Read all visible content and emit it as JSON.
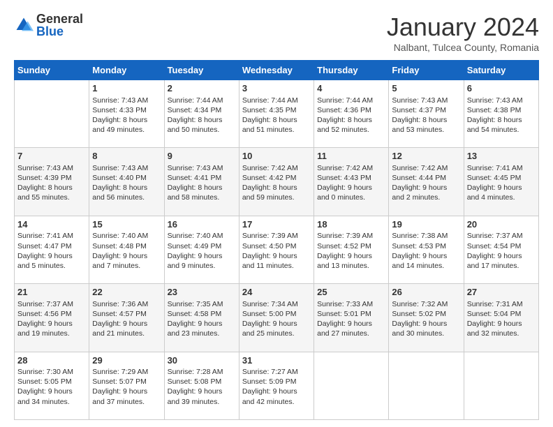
{
  "header": {
    "logo": {
      "general": "General",
      "blue": "Blue"
    },
    "title": "January 2024",
    "location": "Nalbant, Tulcea County, Romania"
  },
  "weekdays": [
    "Sunday",
    "Monday",
    "Tuesday",
    "Wednesday",
    "Thursday",
    "Friday",
    "Saturday"
  ],
  "weeks": [
    [
      {
        "day": "",
        "sunrise": "",
        "sunset": "",
        "daylight": ""
      },
      {
        "day": "1",
        "sunrise": "Sunrise: 7:43 AM",
        "sunset": "Sunset: 4:33 PM",
        "daylight": "Daylight: 8 hours and 49 minutes."
      },
      {
        "day": "2",
        "sunrise": "Sunrise: 7:44 AM",
        "sunset": "Sunset: 4:34 PM",
        "daylight": "Daylight: 8 hours and 50 minutes."
      },
      {
        "day": "3",
        "sunrise": "Sunrise: 7:44 AM",
        "sunset": "Sunset: 4:35 PM",
        "daylight": "Daylight: 8 hours and 51 minutes."
      },
      {
        "day": "4",
        "sunrise": "Sunrise: 7:44 AM",
        "sunset": "Sunset: 4:36 PM",
        "daylight": "Daylight: 8 hours and 52 minutes."
      },
      {
        "day": "5",
        "sunrise": "Sunrise: 7:43 AM",
        "sunset": "Sunset: 4:37 PM",
        "daylight": "Daylight: 8 hours and 53 minutes."
      },
      {
        "day": "6",
        "sunrise": "Sunrise: 7:43 AM",
        "sunset": "Sunset: 4:38 PM",
        "daylight": "Daylight: 8 hours and 54 minutes."
      }
    ],
    [
      {
        "day": "7",
        "sunrise": "Sunrise: 7:43 AM",
        "sunset": "Sunset: 4:39 PM",
        "daylight": "Daylight: 8 hours and 55 minutes."
      },
      {
        "day": "8",
        "sunrise": "Sunrise: 7:43 AM",
        "sunset": "Sunset: 4:40 PM",
        "daylight": "Daylight: 8 hours and 56 minutes."
      },
      {
        "day": "9",
        "sunrise": "Sunrise: 7:43 AM",
        "sunset": "Sunset: 4:41 PM",
        "daylight": "Daylight: 8 hours and 58 minutes."
      },
      {
        "day": "10",
        "sunrise": "Sunrise: 7:42 AM",
        "sunset": "Sunset: 4:42 PM",
        "daylight": "Daylight: 8 hours and 59 minutes."
      },
      {
        "day": "11",
        "sunrise": "Sunrise: 7:42 AM",
        "sunset": "Sunset: 4:43 PM",
        "daylight": "Daylight: 9 hours and 0 minutes."
      },
      {
        "day": "12",
        "sunrise": "Sunrise: 7:42 AM",
        "sunset": "Sunset: 4:44 PM",
        "daylight": "Daylight: 9 hours and 2 minutes."
      },
      {
        "day": "13",
        "sunrise": "Sunrise: 7:41 AM",
        "sunset": "Sunset: 4:45 PM",
        "daylight": "Daylight: 9 hours and 4 minutes."
      }
    ],
    [
      {
        "day": "14",
        "sunrise": "Sunrise: 7:41 AM",
        "sunset": "Sunset: 4:47 PM",
        "daylight": "Daylight: 9 hours and 5 minutes."
      },
      {
        "day": "15",
        "sunrise": "Sunrise: 7:40 AM",
        "sunset": "Sunset: 4:48 PM",
        "daylight": "Daylight: 9 hours and 7 minutes."
      },
      {
        "day": "16",
        "sunrise": "Sunrise: 7:40 AM",
        "sunset": "Sunset: 4:49 PM",
        "daylight": "Daylight: 9 hours and 9 minutes."
      },
      {
        "day": "17",
        "sunrise": "Sunrise: 7:39 AM",
        "sunset": "Sunset: 4:50 PM",
        "daylight": "Daylight: 9 hours and 11 minutes."
      },
      {
        "day": "18",
        "sunrise": "Sunrise: 7:39 AM",
        "sunset": "Sunset: 4:52 PM",
        "daylight": "Daylight: 9 hours and 13 minutes."
      },
      {
        "day": "19",
        "sunrise": "Sunrise: 7:38 AM",
        "sunset": "Sunset: 4:53 PM",
        "daylight": "Daylight: 9 hours and 14 minutes."
      },
      {
        "day": "20",
        "sunrise": "Sunrise: 7:37 AM",
        "sunset": "Sunset: 4:54 PM",
        "daylight": "Daylight: 9 hours and 17 minutes."
      }
    ],
    [
      {
        "day": "21",
        "sunrise": "Sunrise: 7:37 AM",
        "sunset": "Sunset: 4:56 PM",
        "daylight": "Daylight: 9 hours and 19 minutes."
      },
      {
        "day": "22",
        "sunrise": "Sunrise: 7:36 AM",
        "sunset": "Sunset: 4:57 PM",
        "daylight": "Daylight: 9 hours and 21 minutes."
      },
      {
        "day": "23",
        "sunrise": "Sunrise: 7:35 AM",
        "sunset": "Sunset: 4:58 PM",
        "daylight": "Daylight: 9 hours and 23 minutes."
      },
      {
        "day": "24",
        "sunrise": "Sunrise: 7:34 AM",
        "sunset": "Sunset: 5:00 PM",
        "daylight": "Daylight: 9 hours and 25 minutes."
      },
      {
        "day": "25",
        "sunrise": "Sunrise: 7:33 AM",
        "sunset": "Sunset: 5:01 PM",
        "daylight": "Daylight: 9 hours and 27 minutes."
      },
      {
        "day": "26",
        "sunrise": "Sunrise: 7:32 AM",
        "sunset": "Sunset: 5:02 PM",
        "daylight": "Daylight: 9 hours and 30 minutes."
      },
      {
        "day": "27",
        "sunrise": "Sunrise: 7:31 AM",
        "sunset": "Sunset: 5:04 PM",
        "daylight": "Daylight: 9 hours and 32 minutes."
      }
    ],
    [
      {
        "day": "28",
        "sunrise": "Sunrise: 7:30 AM",
        "sunset": "Sunset: 5:05 PM",
        "daylight": "Daylight: 9 hours and 34 minutes."
      },
      {
        "day": "29",
        "sunrise": "Sunrise: 7:29 AM",
        "sunset": "Sunset: 5:07 PM",
        "daylight": "Daylight: 9 hours and 37 minutes."
      },
      {
        "day": "30",
        "sunrise": "Sunrise: 7:28 AM",
        "sunset": "Sunset: 5:08 PM",
        "daylight": "Daylight: 9 hours and 39 minutes."
      },
      {
        "day": "31",
        "sunrise": "Sunrise: 7:27 AM",
        "sunset": "Sunset: 5:09 PM",
        "daylight": "Daylight: 9 hours and 42 minutes."
      },
      {
        "day": "",
        "sunrise": "",
        "sunset": "",
        "daylight": ""
      },
      {
        "day": "",
        "sunrise": "",
        "sunset": "",
        "daylight": ""
      },
      {
        "day": "",
        "sunrise": "",
        "sunset": "",
        "daylight": ""
      }
    ]
  ]
}
